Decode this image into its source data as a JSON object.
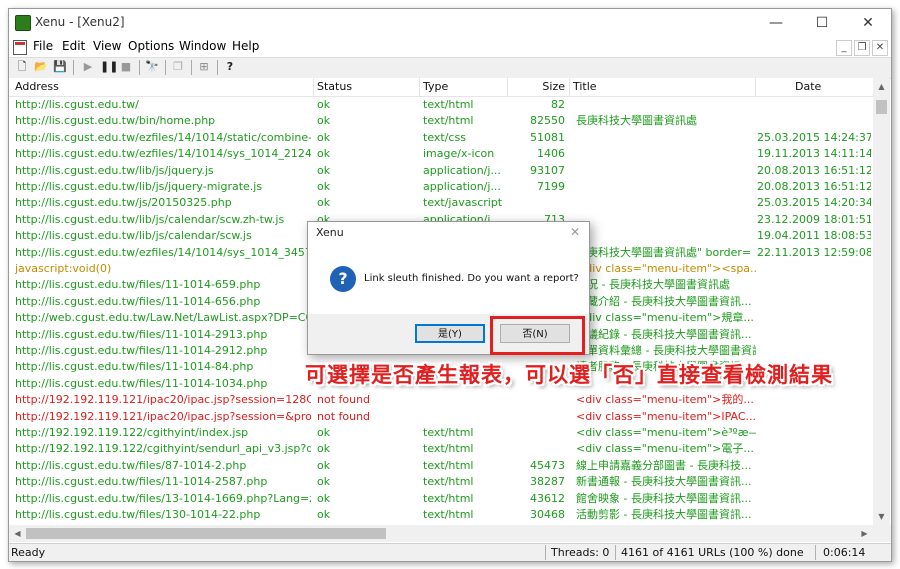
{
  "window": {
    "title": "Xenu - [Xenu2]",
    "controls": {
      "minimize": "—",
      "maximize": "☐",
      "close": "✕"
    }
  },
  "menu": {
    "items": [
      "File",
      "Edit",
      "View",
      "Options",
      "Window",
      "Help"
    ],
    "mdi": {
      "minimize": "_",
      "restore": "❐",
      "close": "✕"
    }
  },
  "toolbar": {
    "icons": [
      "new-icon",
      "open-icon",
      "save-icon",
      "play-icon",
      "pause-icon",
      "stop-icon",
      "find-icon",
      "copy-icon",
      "properties-icon",
      "help-icon"
    ]
  },
  "table": {
    "columns": [
      "Address",
      "Status",
      "Type",
      "Size",
      "Title",
      "Date"
    ],
    "rows": [
      {
        "address": "http://lis.cgust.edu.tw/",
        "status": "ok",
        "type": "text/html",
        "size": "82",
        "title": "",
        "date": "",
        "state": "ok"
      },
      {
        "address": "http://lis.cgust.edu.tw/bin/home.php",
        "status": "ok",
        "type": "text/html",
        "size": "82550",
        "title": "長庚科技大學圖書資訊處",
        "date": "",
        "state": "ok"
      },
      {
        "address": "http://lis.cgust.edu.tw/ezfiles/14/1014/static/combine-zh-...",
        "status": "ok",
        "type": "text/css",
        "size": "51081",
        "title": "",
        "date": "25.03.2015  14:24:37",
        "state": "ok"
      },
      {
        "address": "http://lis.cgust.edu.tw/ezfiles/14/1014/sys_1014_2124812...",
        "status": "ok",
        "type": "image/x-icon",
        "size": "1406",
        "title": "",
        "date": "19.11.2013  14:11:14",
        "state": "ok"
      },
      {
        "address": "http://lis.cgust.edu.tw/lib/js/jquery.js",
        "status": "ok",
        "type": "application/j...",
        "size": "93107",
        "title": "",
        "date": "20.08.2013  16:51:12",
        "state": "ok"
      },
      {
        "address": "http://lis.cgust.edu.tw/lib/js/jquery-migrate.js",
        "status": "ok",
        "type": "application/j...",
        "size": "7199",
        "title": "",
        "date": "20.08.2013  16:51:12",
        "state": "ok"
      },
      {
        "address": "http://lis.cgust.edu.tw/js/20150325.php",
        "status": "ok",
        "type": "text/javascript",
        "size": "",
        "title": "",
        "date": "25.03.2015  14:20:34",
        "state": "ok"
      },
      {
        "address": "http://lis.cgust.edu.tw/lib/js/calendar/scw.zh-tw.js",
        "status": "ok",
        "type": "application/j...",
        "size": "713",
        "title": "",
        "date": "23.12.2009  18:01:51",
        "state": "ok"
      },
      {
        "address": "http://lis.cgust.edu.tw/lib/js/calendar/scw.js",
        "status": "",
        "type": "",
        "size": "",
        "title": "",
        "date": "19.04.2011  18:08:53",
        "state": "ok"
      },
      {
        "address": "http://lis.cgust.edu.tw/ezfiles/14/1014/sys_1014_3457381...",
        "status": "",
        "type": "",
        "size": "",
        "title": "長庚科技大學圖書資訊處\" border=",
        "date": "22.11.2013  12:59:08",
        "state": "ok"
      },
      {
        "address": "javascript:void(0)",
        "status": "",
        "type": "",
        "size": "",
        "title": "<div class=\"menu-item\"><spa...",
        "date": "",
        "state": "js"
      },
      {
        "address": "http://lis.cgust.edu.tw/files/11-1014-659.php",
        "status": "",
        "type": "",
        "size": "",
        "title": "概況 - 長庚科技大學圖書資訊處",
        "date": "",
        "state": "ok"
      },
      {
        "address": "http://lis.cgust.edu.tw/files/11-1014-656.php",
        "status": "",
        "type": "",
        "size": "",
        "title": "館藏介紹 - 長庚科技大學圖書資訊...",
        "date": "",
        "state": "ok"
      },
      {
        "address": "http://web.cgust.edu.tw/Law.Net/LawList.aspx?DP=C000",
        "status": "",
        "type": "",
        "size": "",
        "title": "<div class=\"menu-item\">規章...",
        "date": "",
        "state": "ok"
      },
      {
        "address": "http://lis.cgust.edu.tw/files/11-1014-2913.php",
        "status": "",
        "type": "",
        "size": "",
        "title": "會議紀錄 - 長庚科技大學圖書資訊...",
        "date": "",
        "state": "ok"
      },
      {
        "address": "http://lis.cgust.edu.tw/files/11-1014-2912.php",
        "status": "",
        "type": "",
        "size": "",
        "title": "表單資料彙總 - 長庚科技大學圖書資訊...",
        "date": "",
        "state": "ok"
      },
      {
        "address": "http://lis.cgust.edu.tw/files/11-1014-84.php",
        "status": "",
        "type": "",
        "size": "",
        "title": "讀者服務 - 長庚科技大學圖書資訊...",
        "date": "",
        "state": "ok"
      },
      {
        "address": "http://lis.cgust.edu.tw/files/11-1014-1034.php",
        "status": "",
        "type": "",
        "size": "",
        "title": "",
        "date": "",
        "state": "ok"
      },
      {
        "address": "http://192.192.119.121/ipac20/ipac.jsp?session=128C974...",
        "status": "not found",
        "type": "",
        "size": "",
        "title": "<div class=\"menu-item\">我的...",
        "date": "",
        "state": "err"
      },
      {
        "address": "http://192.192.119.121/ipac20/ipac.jsp?session=&profile...",
        "status": "not found",
        "type": "",
        "size": "",
        "title": "<div class=\"menu-item\">IPAC...",
        "date": "",
        "state": "err"
      },
      {
        "address": "http://192.192.119.122/cgithyint/index.jsp",
        "status": "ok",
        "type": "text/html",
        "size": "",
        "title": "<div class=\"menu-item\">è³ºæ—...",
        "date": "",
        "state": "ok"
      },
      {
        "address": "http://192.192.119.122/cgithyint/sendurl_api_v3.jsp?dbid...",
        "status": "ok",
        "type": "text/html",
        "size": "",
        "title": "<div class=\"menu-item\">電子...",
        "date": "",
        "state": "ok"
      },
      {
        "address": "http://lis.cgust.edu.tw/files/87-1014-2.php",
        "status": "ok",
        "type": "text/html",
        "size": "45473",
        "title": "線上申請嘉義分部圖書 - 長庚科技...",
        "date": "",
        "state": "ok"
      },
      {
        "address": "http://lis.cgust.edu.tw/files/11-1014-2587.php",
        "status": "ok",
        "type": "text/html",
        "size": "38287",
        "title": "新書通報 - 長庚科技大學圖書資訊...",
        "date": "",
        "state": "ok"
      },
      {
        "address": "http://lis.cgust.edu.tw/files/13-1014-1669.php?Lang=zh-tw",
        "status": "ok",
        "type": "text/html",
        "size": "43612",
        "title": "館舍映象 - 長庚科技大學圖書資訊...",
        "date": "",
        "state": "ok"
      },
      {
        "address": "http://lis.cgust.edu.tw/files/130-1014-22.php",
        "status": "ok",
        "type": "text/html",
        "size": "30468",
        "title": "活動剪影 - 長庚科技大學圖書資訊...",
        "date": "",
        "state": "ok"
      },
      {
        "address": "http://lis.cgust.edu.tw/files/11-1014-0.php",
        "status": "ok",
        "type": "text/html",
        "size": "",
        "title": "",
        "date": "",
        "state": "ok"
      }
    ]
  },
  "status": {
    "ready": "Ready",
    "threads": "Threads: 0",
    "urls": "4161 of 4161 URLs (100 %) done",
    "elapsed": "0:06:14"
  },
  "dialog": {
    "title": "Xenu",
    "close": "✕",
    "icon": "question-icon",
    "icon_glyph": "?",
    "message": "Link sleuth finished. Do you want a report?",
    "yes_label": "是(Y)",
    "no_label": "否(N)"
  },
  "annotation": {
    "text": "可選擇是否產生報表，可以選「否」直接查看檢測結果"
  },
  "colors": {
    "ok": "#1e9b1e",
    "not_found": "#e21b1b",
    "javascript": "#c68a00",
    "annotation": "#e02020",
    "highlight_box": "#e32020"
  }
}
